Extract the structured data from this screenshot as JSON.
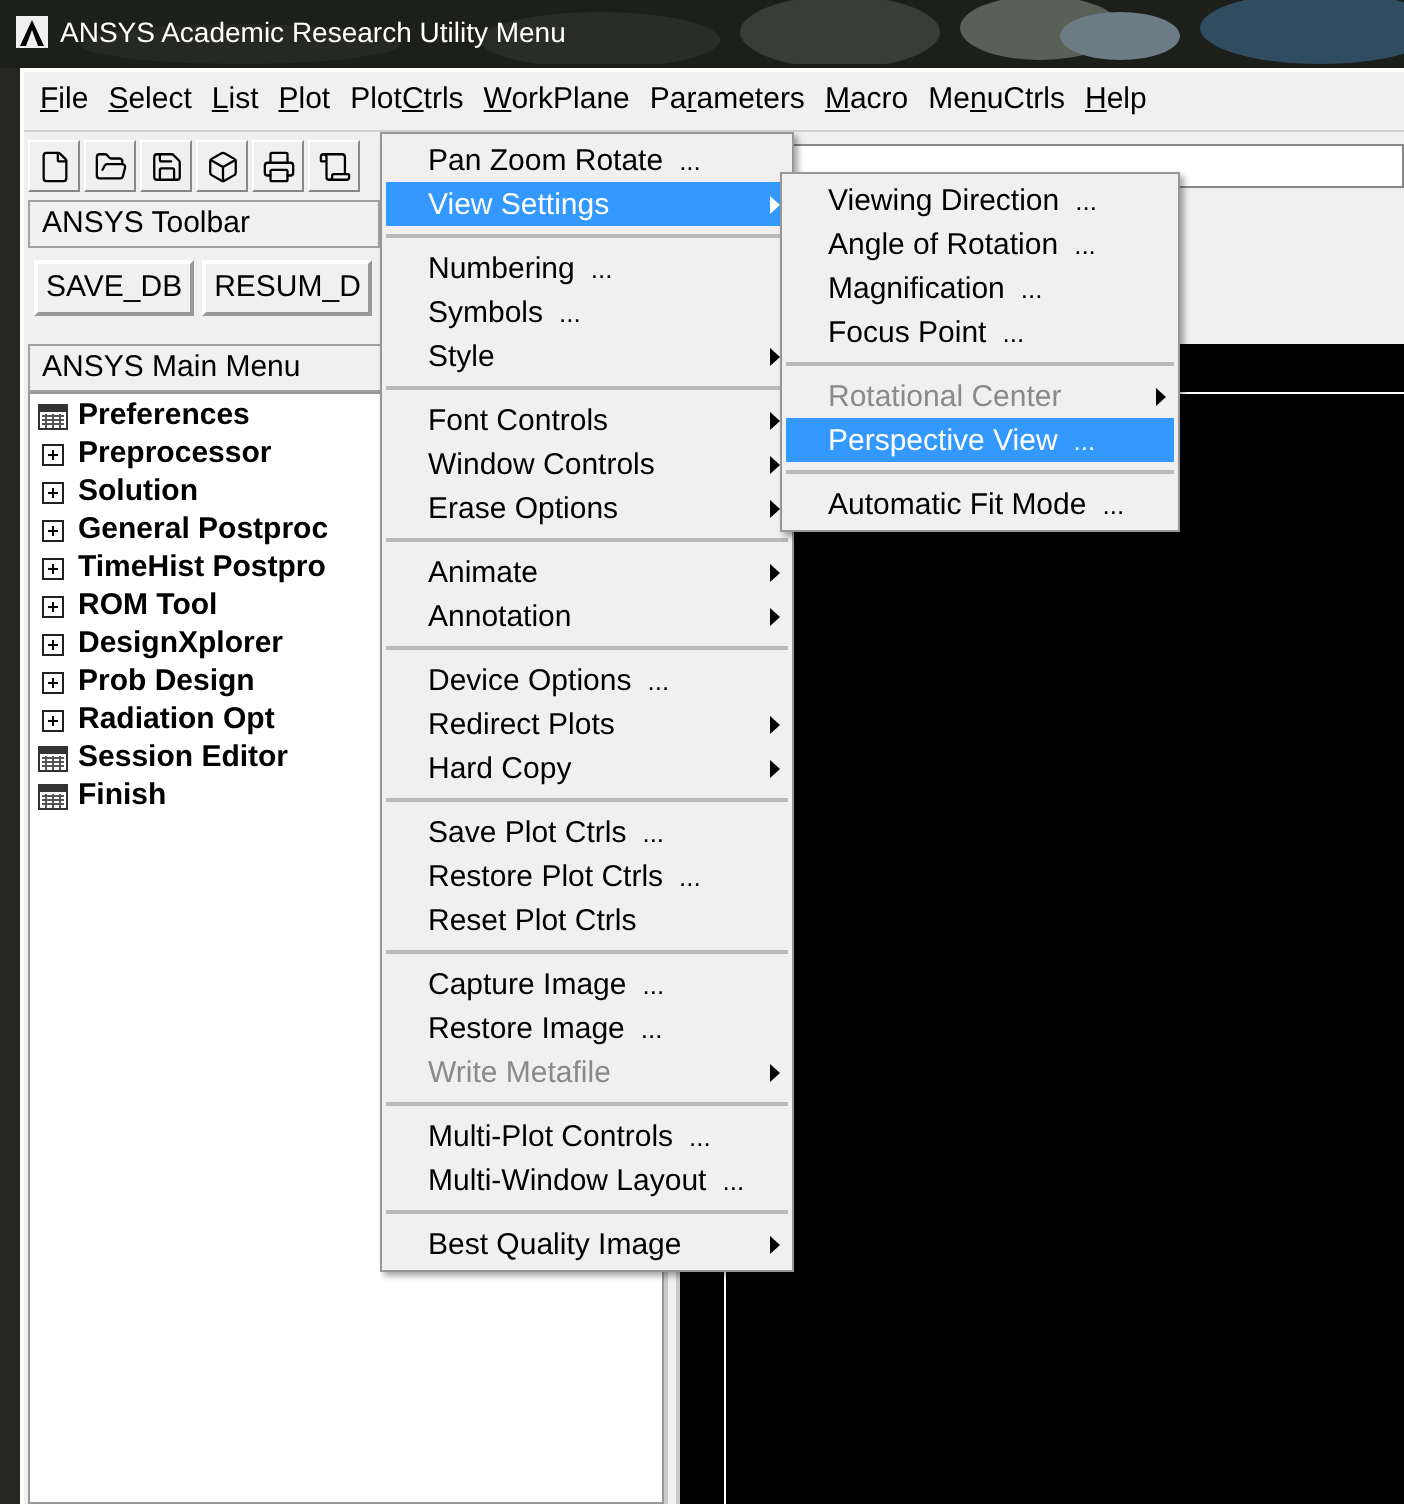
{
  "window": {
    "title": "ANSYS Academic Research Utility Menu"
  },
  "menu_bar": [
    {
      "key": "F",
      "post": "ile"
    },
    {
      "key": "S",
      "post": "elect"
    },
    {
      "key": "L",
      "post": "ist"
    },
    {
      "key": "P",
      "post": "lot"
    },
    {
      "pre": "Plot",
      "key": "C",
      "post": "trls"
    },
    {
      "key": "W",
      "post": "orkPlane"
    },
    {
      "pre": "Pa",
      "key": "r",
      "post": "ameters"
    },
    {
      "key": "M",
      "post": "acro"
    },
    {
      "pre": "Me",
      "key": "n",
      "post": "uCtrls"
    },
    {
      "key": "H",
      "post": "elp"
    }
  ],
  "toolbar_title": "ANSYS Toolbar",
  "toolbar_buttons": [
    "SAVE_DB",
    "RESUM_D"
  ],
  "main_menu": {
    "title": "ANSYS Main Menu",
    "items": [
      {
        "label": "Preferences",
        "kind": "leaf"
      },
      {
        "label": "Preprocessor",
        "kind": "folder",
        "expanded": false
      },
      {
        "label": "Solution",
        "kind": "folder",
        "expanded": false
      },
      {
        "label": "General Postproc",
        "kind": "folder",
        "expanded": false
      },
      {
        "label": "TimeHist Postpro",
        "kind": "folder",
        "expanded": false
      },
      {
        "label": "ROM Tool",
        "kind": "folder",
        "expanded": false
      },
      {
        "label": "DesignXplorer",
        "kind": "folder",
        "expanded": false
      },
      {
        "label": "Prob Design",
        "kind": "folder",
        "expanded": false
      },
      {
        "label": "Radiation Opt",
        "kind": "folder",
        "expanded": false
      },
      {
        "label": "Session Editor",
        "kind": "leaf"
      },
      {
        "label": "Finish",
        "kind": "leaf"
      }
    ]
  },
  "plotctrls_menu": [
    [
      {
        "label": "Pan Zoom Rotate",
        "suffix": "...",
        "submenu": false,
        "disabled": false,
        "selected": false
      },
      {
        "label": "View Settings",
        "submenu": true,
        "disabled": false,
        "selected": true
      }
    ],
    [
      {
        "label": "Numbering",
        "suffix": "...",
        "submenu": false,
        "disabled": false,
        "selected": false
      },
      {
        "label": "Symbols",
        "suffix": "...",
        "submenu": false,
        "disabled": false,
        "selected": false
      },
      {
        "label": "Style",
        "submenu": true,
        "disabled": false,
        "selected": false
      }
    ],
    [
      {
        "label": "Font Controls",
        "submenu": true,
        "disabled": false,
        "selected": false
      },
      {
        "label": "Window Controls",
        "submenu": true,
        "disabled": false,
        "selected": false
      },
      {
        "label": "Erase Options",
        "submenu": true,
        "disabled": false,
        "selected": false
      }
    ],
    [
      {
        "label": "Animate",
        "submenu": true,
        "disabled": false,
        "selected": false
      },
      {
        "label": "Annotation",
        "submenu": true,
        "disabled": false,
        "selected": false
      }
    ],
    [
      {
        "label": "Device Options",
        "suffix": "...",
        "submenu": false,
        "disabled": false,
        "selected": false
      },
      {
        "label": "Redirect Plots",
        "submenu": true,
        "disabled": false,
        "selected": false
      },
      {
        "label": "Hard Copy",
        "submenu": true,
        "disabled": false,
        "selected": false
      }
    ],
    [
      {
        "label": "Save Plot Ctrls",
        "suffix": "...",
        "submenu": false,
        "disabled": false,
        "selected": false
      },
      {
        "label": "Restore Plot Ctrls",
        "suffix": "...",
        "submenu": false,
        "disabled": false,
        "selected": false
      },
      {
        "label": "Reset Plot Ctrls",
        "submenu": false,
        "disabled": false,
        "selected": false
      }
    ],
    [
      {
        "label": "Capture Image",
        "suffix": "...",
        "submenu": false,
        "disabled": false,
        "selected": false
      },
      {
        "label": "Restore Image",
        "suffix": "...",
        "submenu": false,
        "disabled": false,
        "selected": false
      },
      {
        "label": "Write Metafile",
        "submenu": true,
        "disabled": true,
        "selected": false
      }
    ],
    [
      {
        "label": "Multi-Plot Controls",
        "suffix": "...",
        "submenu": false,
        "disabled": false,
        "selected": false
      },
      {
        "label": "Multi-Window Layout",
        "suffix": "...",
        "submenu": false,
        "disabled": false,
        "selected": false
      }
    ],
    [
      {
        "label": "Best Quality Image",
        "submenu": true,
        "disabled": false,
        "selected": false
      }
    ]
  ],
  "view_settings_menu": [
    [
      {
        "label": "Viewing Direction",
        "suffix": "...",
        "submenu": false,
        "disabled": false,
        "selected": false
      },
      {
        "label": "Angle of Rotation",
        "suffix": "...",
        "submenu": false,
        "disabled": false,
        "selected": false
      },
      {
        "label": "Magnification",
        "suffix": "...",
        "submenu": false,
        "disabled": false,
        "selected": false
      },
      {
        "label": "Focus Point",
        "suffix": "...",
        "submenu": false,
        "disabled": false,
        "selected": false
      }
    ],
    [
      {
        "label": "Rotational Center",
        "submenu": true,
        "disabled": true,
        "selected": false
      },
      {
        "label": "Perspective View",
        "suffix": "...",
        "submenu": false,
        "disabled": false,
        "selected": true
      }
    ],
    [
      {
        "label": "Automatic Fit Mode",
        "suffix": "...",
        "submenu": false,
        "disabled": false,
        "selected": false
      }
    ]
  ]
}
